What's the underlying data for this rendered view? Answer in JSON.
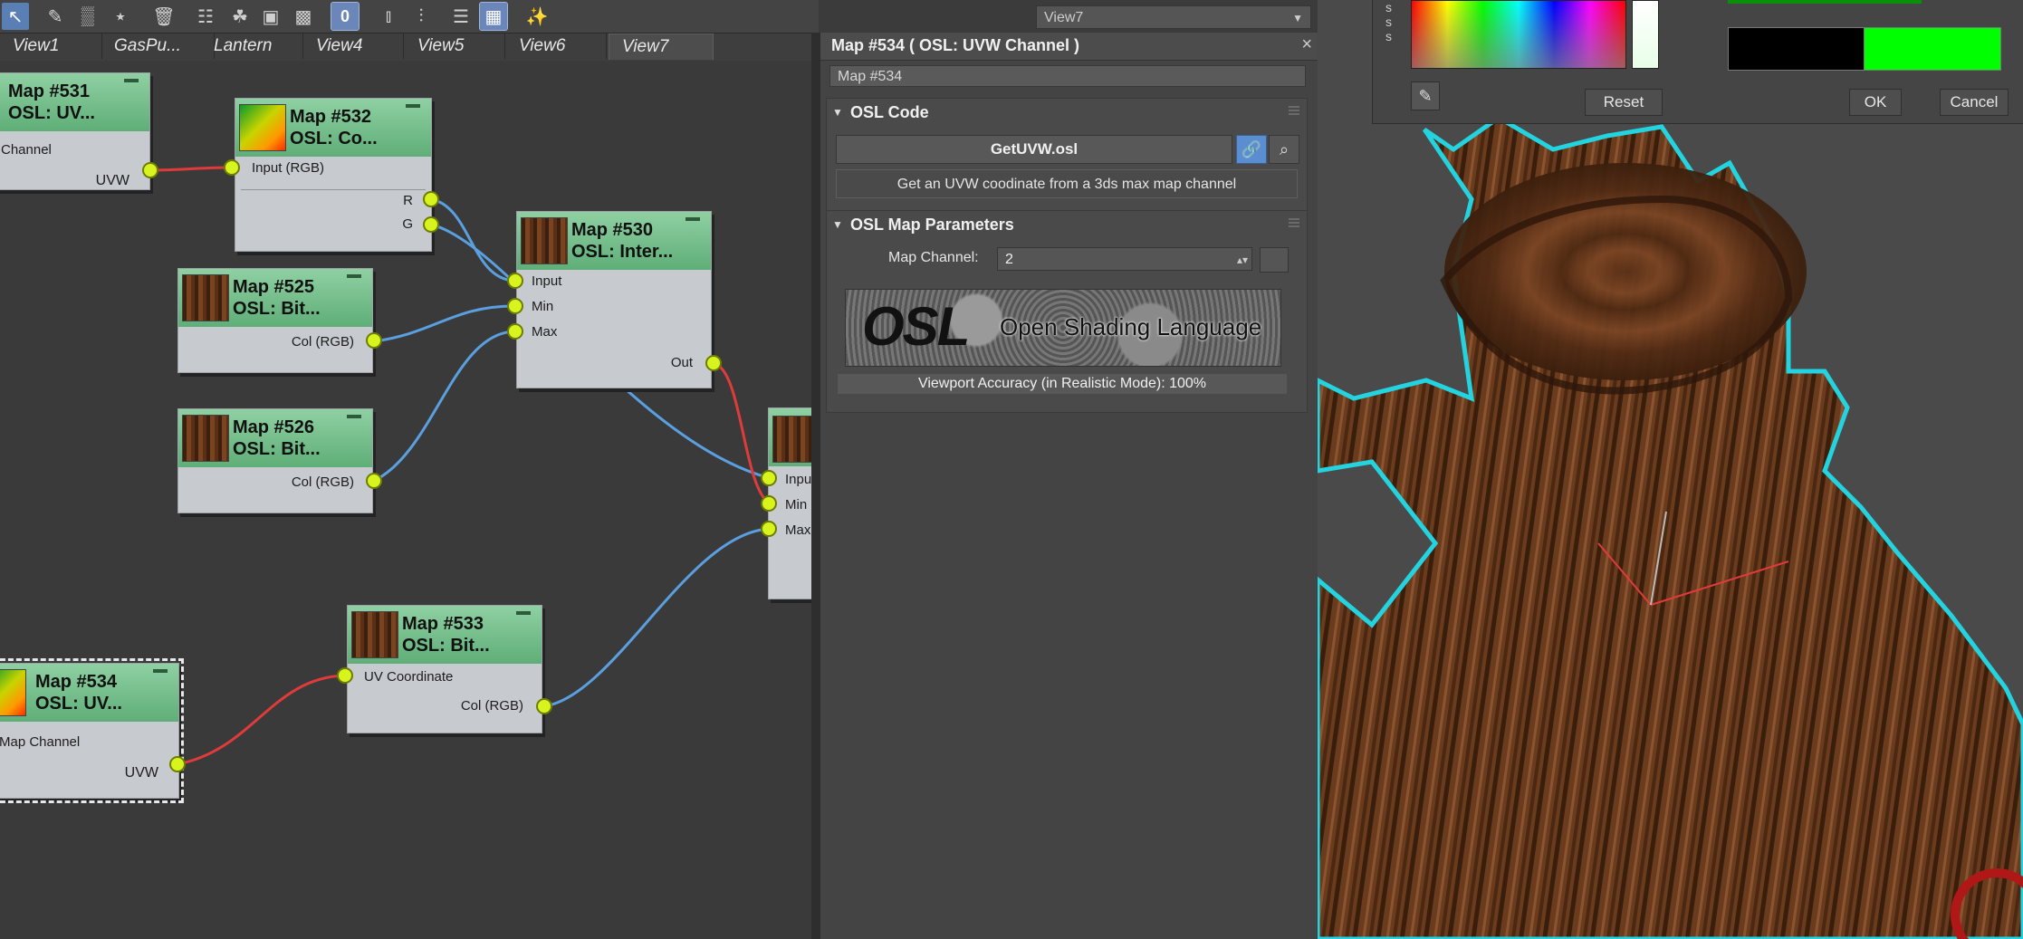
{
  "toolbar": {
    "icons": [
      "select-arrow-icon",
      "pick-icon",
      "paint-icon",
      "link-node-icon",
      "trash-icon",
      "layout-icon",
      "hierarchy-icon",
      "box-icon",
      "pattern-icon",
      "zero-icon",
      "align-icon",
      "distribute-icon",
      "list-icon",
      "viewport-icon",
      "wand-icon"
    ],
    "zero_label": "0"
  },
  "view_select": {
    "value": "View7"
  },
  "view_tabs": [
    "View1",
    "GasPu...",
    "Lantern",
    "View4",
    "View5",
    "View6",
    "View7"
  ],
  "active_view_tab": "View7",
  "nodes": {
    "n531": {
      "title": "Map #531",
      "sub": "OSL: UV...",
      "ports": [
        "Channel",
        "UVW"
      ]
    },
    "n532": {
      "title": "Map #532",
      "sub": "OSL: Co...",
      "ports": [
        "Input (RGB)",
        "R",
        "G"
      ]
    },
    "n530": {
      "title": "Map #530",
      "sub": "OSL: Inter...",
      "ports": [
        "Input",
        "Min",
        "Max",
        "Out"
      ]
    },
    "n525": {
      "title": "Map #525",
      "sub": "OSL: Bit...",
      "ports": [
        "Col (RGB)"
      ]
    },
    "n526": {
      "title": "Map #526",
      "sub": "OSL: Bit...",
      "ports": [
        "Col (RGB)"
      ]
    },
    "n533": {
      "title": "Map #533",
      "sub": "OSL: Bit...",
      "ports": [
        "UV Coordinate",
        "Col (RGB)"
      ]
    },
    "n534": {
      "title": "Map #534",
      "sub": "OSL: UV...",
      "ports": [
        "Map Channel",
        "UVW"
      ]
    },
    "ncut": {
      "ports": [
        "Inpu",
        "Min",
        "Max"
      ]
    }
  },
  "panel": {
    "title": "Map #534  ( OSL: UVW Channel )",
    "close": "×",
    "name_value": "Map #534",
    "osl_code": {
      "header": "OSL Code",
      "file_button": "GetUVW.osl",
      "description": "Get an UVW coodinate from a 3ds max map channel"
    },
    "osl_params": {
      "header": "OSL Map Parameters",
      "map_channel_label": "Map Channel:",
      "map_channel_value": "2",
      "logo_big": "OSL",
      "logo_text": "Open Shading Language",
      "viewport_accuracy": "Viewport Accuracy (in Realistic Mode): 100%"
    }
  },
  "color_dialog": {
    "side_letters": "s\ns\ns",
    "reset": "Reset",
    "ok": "OK",
    "cancel": "Cancel",
    "old_color": "#000000",
    "new_color": "#00ff00"
  },
  "colors": {
    "node_header": "#6fbe86",
    "socket": "#d8f41e",
    "wire_blue": "#5aa0e0",
    "wire_red": "#e03b3b",
    "selection_outline": "#23d4e0",
    "wood": "#6b3b1d"
  }
}
